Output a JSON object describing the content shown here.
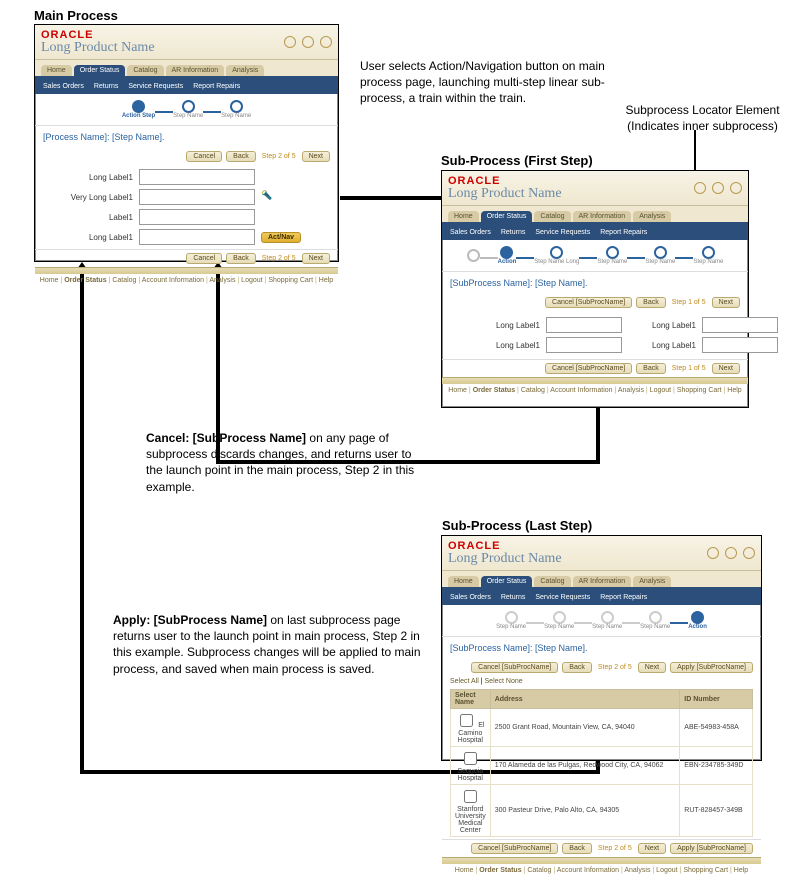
{
  "sections": {
    "main_title": "Main Process",
    "sub_first_title": "Sub-Process (First Step)",
    "sub_last_title": "Sub-Process (Last Step)"
  },
  "captions": {
    "top_right": "User selects Action/Navigation button on main process page, launching multi-step linear sub-process, a train within the train.",
    "locator_label": "Subprocess Locator Element",
    "locator_sub": "(Indicates inner subprocess)",
    "cancel_lead": "Cancel: [SubProcess Name]",
    "cancel_body": " on any page of subprocess discards changes, and returns user to the launch point in the main process, Step 2 in this example.",
    "apply_lead": "Apply: [SubProcess Name]",
    "apply_body": " on last subprocess page returns user to the launch point in main process, Step 2 in this example. Subprocess changes will be applied to main process, and saved when main process is saved."
  },
  "shared": {
    "brand": "ORACLE",
    "product": "Long Product Name",
    "header_links": [
      "Logout",
      "Shopping Cart",
      "Help"
    ],
    "tabs": [
      "Home",
      "Order Status",
      "Catalog",
      "AR Information",
      "Analysis"
    ],
    "active_tab": 1,
    "bluebar_items": [
      "Sales Orders",
      "Returns",
      "Service Requests",
      "Report Repairs"
    ],
    "footer_links": [
      "Home",
      "Order Status",
      "Catalog",
      "Account Information",
      "Analysis",
      "Logout",
      "Shopping Cart",
      "Help"
    ],
    "footer_bold": 1
  },
  "main": {
    "crumb": "[Process Name]: [Step Name].",
    "train_nodes": [
      "Action Step",
      "Step Name",
      "Step Name"
    ],
    "train_current": 0,
    "btn_cancel": "Cancel",
    "btn_back": "Back",
    "step_ind": "Step 2 of 5",
    "btn_next": "Next",
    "fields": [
      "Long Label1",
      "Very Long Label1",
      "Label1",
      "Long Label1"
    ],
    "actnav": "Act/Nav"
  },
  "sub_first": {
    "crumb": "[SubProcess Name]: [Step Name].",
    "train_nodes": [
      "Action",
      "Step Name Long",
      "Step Name",
      "Step Name",
      "Step Name"
    ],
    "train_current": 0,
    "btn_cancel": "Cancel [SubProcName]",
    "btn_back": "Back",
    "step_ind": "Step 1 of 5",
    "btn_next": "Next",
    "fields_left": [
      "Long Label1",
      "Long Label1"
    ],
    "fields_right": [
      "Long Label1",
      "Long Label1"
    ]
  },
  "sub_last": {
    "crumb": "[SubProcess Name]: [Step Name].",
    "train_nodes": [
      "Step Name",
      "Step Name",
      "Step Name",
      "Step Name",
      "Action"
    ],
    "train_current": 4,
    "btn_cancel": "Cancel [SubProcName]",
    "btn_back": "Back",
    "step_ind": "Step 2 of 5",
    "btn_next": "Next",
    "btn_apply": "Apply [SubProcName]",
    "select_all": "Select All",
    "select_none": "Select None",
    "table": {
      "headers": [
        "Select Name",
        "Address",
        "ID Number"
      ],
      "rows": [
        {
          "name": "El Camino Hospital",
          "addr": "2500 Grant Road, Mountain View, CA, 94040",
          "id": "ABE-54983-458A"
        },
        {
          "name": "Sequoia Hospital",
          "addr": "170 Alameda de las Pulgas, Redwood City, CA, 94062",
          "id": "EBN-234785-349D"
        },
        {
          "name": "Stanford University Medical Center",
          "addr": "300 Pasteur Drive, Palo Alto, CA, 94305",
          "id": "RUT-828457-349B"
        }
      ]
    }
  }
}
